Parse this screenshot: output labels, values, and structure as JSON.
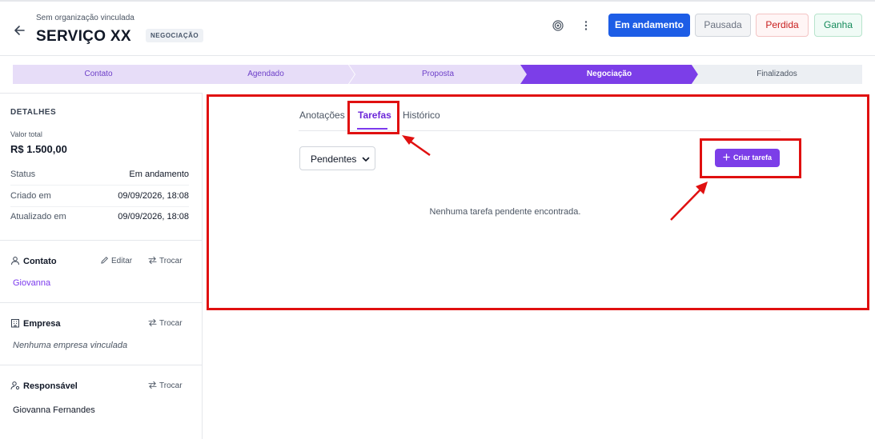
{
  "header": {
    "org_label": "Sem organização vinculada",
    "title": "SERVIÇO XX",
    "stage_badge": "NEGOCIAÇÃO",
    "status_buttons": {
      "em_andamento": "Em andamento",
      "pausada": "Pausada",
      "perdida": "Perdida",
      "ganha": "Ganha"
    }
  },
  "pipeline": {
    "stages": [
      "Contato",
      "Agendado",
      "Proposta",
      "Negociação",
      "Finalizados"
    ],
    "current_index": 3
  },
  "sidebar": {
    "details_title": "DETALHES",
    "valor_total_label": "Valor total",
    "valor_total_value": "R$ 1.500,00",
    "rows": [
      {
        "label": "Status",
        "value": "Em andamento"
      },
      {
        "label": "Criado em",
        "value": "09/09/2026, 18:08"
      },
      {
        "label": "Atualizado em",
        "value": "09/09/2026, 18:08"
      }
    ],
    "contato": {
      "title": "Contato",
      "edit_label": "Editar",
      "swap_label": "Trocar",
      "name": "Giovanna"
    },
    "empresa": {
      "title": "Empresa",
      "swap_label": "Trocar",
      "empty": "Nenhuma empresa vinculada"
    },
    "responsavel": {
      "title": "Responsável",
      "swap_label": "Trocar",
      "name": "Giovanna Fernandes"
    }
  },
  "main": {
    "tabs": [
      "Anotações",
      "Tarefas",
      "Histórico"
    ],
    "active_tab": "Tarefas",
    "filter_value": "Pendentes",
    "create_button": "Criar tarefa",
    "empty_message": "Nenhuma tarefa pendente encontrada."
  },
  "colors": {
    "accent": "#7c3ee8",
    "primary": "#1d5de6",
    "annotation": "#e01010"
  }
}
